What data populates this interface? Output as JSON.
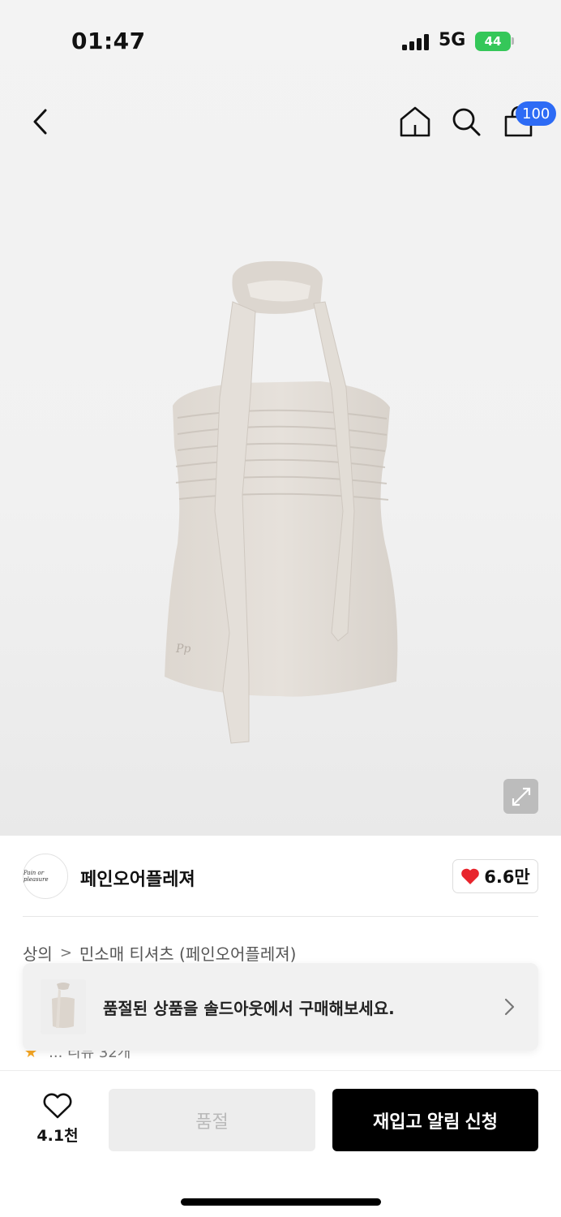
{
  "status_bar": {
    "time": "01:47",
    "network": "5G",
    "battery": "44"
  },
  "header": {
    "cart_count": "100"
  },
  "brand": {
    "logo_text": "Pain or pleasure",
    "name": "페인오어플레져",
    "likes": "6.6만"
  },
  "breadcrumb": {
    "category": "상의",
    "separator": ">",
    "subcategory": "민소매 티셔츠 (페인오어플레져)"
  },
  "partially_hidden": {
    "text": "... 리뷰 32개"
  },
  "soldout_banner": {
    "message": "품절된 상품을 솔드아웃에서 구매해보세요."
  },
  "bottom_bar": {
    "wishlist_count": "4.1천",
    "soldout_label": "품절",
    "restock_label": "재입고 알림 신청"
  },
  "colors": {
    "accent_blue": "#2d6bf5",
    "heart_red": "#e8242c",
    "battery_green": "#35c759",
    "primary_button": "#000000"
  },
  "icons": [
    "back-icon",
    "home-icon",
    "search-icon",
    "cart-icon",
    "expand-icon",
    "heart-icon",
    "chevron-right-icon"
  ]
}
